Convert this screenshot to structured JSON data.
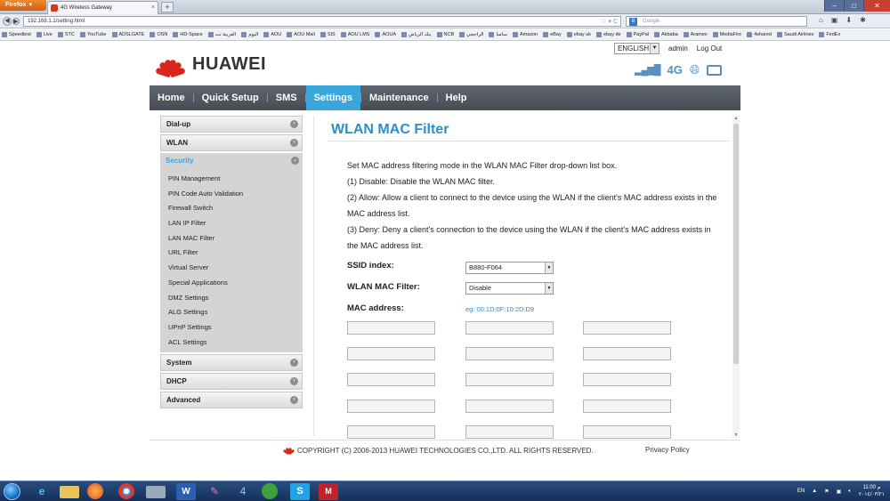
{
  "browser": {
    "menu_label": "Firefox",
    "tab_title": "4G Wireless Gateway",
    "url": "192.168.1.1/setting.html",
    "search_placeholder": "Google",
    "bookmarks": [
      "Speedtest",
      "Live",
      "STC",
      "YouTube",
      "ADSLGATE",
      "OSN",
      "HD-Space",
      "العربية نت",
      "اليوم",
      "AOU",
      "AOU Mail",
      "SIS",
      "AOU LMS",
      "AOUA",
      "بنك الرياض",
      "NCB",
      "الراجحي",
      "سامبا",
      "Amazon",
      "eBay",
      "ebay uk",
      "ebay de",
      "PayPal",
      "Akbaba",
      "Aramex",
      "MediaFire",
      "4shared",
      "Saudi Airlines",
      "FedEx"
    ]
  },
  "header": {
    "brand": "HUAWEI",
    "language": "ENGLISH",
    "user": "admin",
    "logout": "Log Out",
    "network": "4G"
  },
  "menu": {
    "items": [
      "Home",
      "Quick Setup",
      "SMS",
      "Settings",
      "Maintenance",
      "Help"
    ],
    "active": "Settings"
  },
  "sidebar": {
    "top_sections": [
      "Dial-up",
      "WLAN"
    ],
    "group_title": "Security",
    "group_items": [
      "PIN Management",
      "PIN Code Auto Validation",
      "Firewall Switch",
      "LAN IP Filter",
      "LAN MAC Filter",
      "URL Filter",
      "Virtual Server",
      "Special Applications",
      "DMZ Settings",
      "ALG Settings",
      "UPnP Settings",
      "ACL Settings"
    ],
    "bottom_sections": [
      "System",
      "DHCP",
      "Advanced"
    ]
  },
  "content": {
    "title": "WLAN MAC Filter",
    "description": [
      "Set MAC address filtering mode in the WLAN MAC Filter drop-down list box.",
      "(1) Disable: Disable the WLAN MAC filter.",
      "(2) Allow: Allow a client to connect to the device using the WLAN if the client's MAC address exists in the MAC address list.",
      "(3) Deny: Deny a client's connection to the device using the WLAN if the client's MAC address exists in the MAC address list."
    ],
    "ssid_label": "SSID index:",
    "ssid_value": "B880-F064",
    "filter_label": "WLAN MAC Filter:",
    "filter_value": "Disable",
    "mac_label": "MAC address:",
    "mac_hint": "eg: 00:1D:0F:10:2D:D9"
  },
  "footer": {
    "copyright": "COPYRIGHT (C) 2006-2013 HUAWEI TECHNOLOGIES CO.,LTD. ALL RIGHTS RESERVED.",
    "privacy": "Privacy Policy"
  },
  "taskbar": {
    "lang": "EN",
    "time": "11:00 م",
    "date": "٢٠١٤/٠٣/٢١"
  },
  "colors": {
    "accent": "#3aa7dc",
    "title": "#2c8fcb",
    "brand_red": "#d9261c",
    "menu_bg": "#4e545b"
  }
}
